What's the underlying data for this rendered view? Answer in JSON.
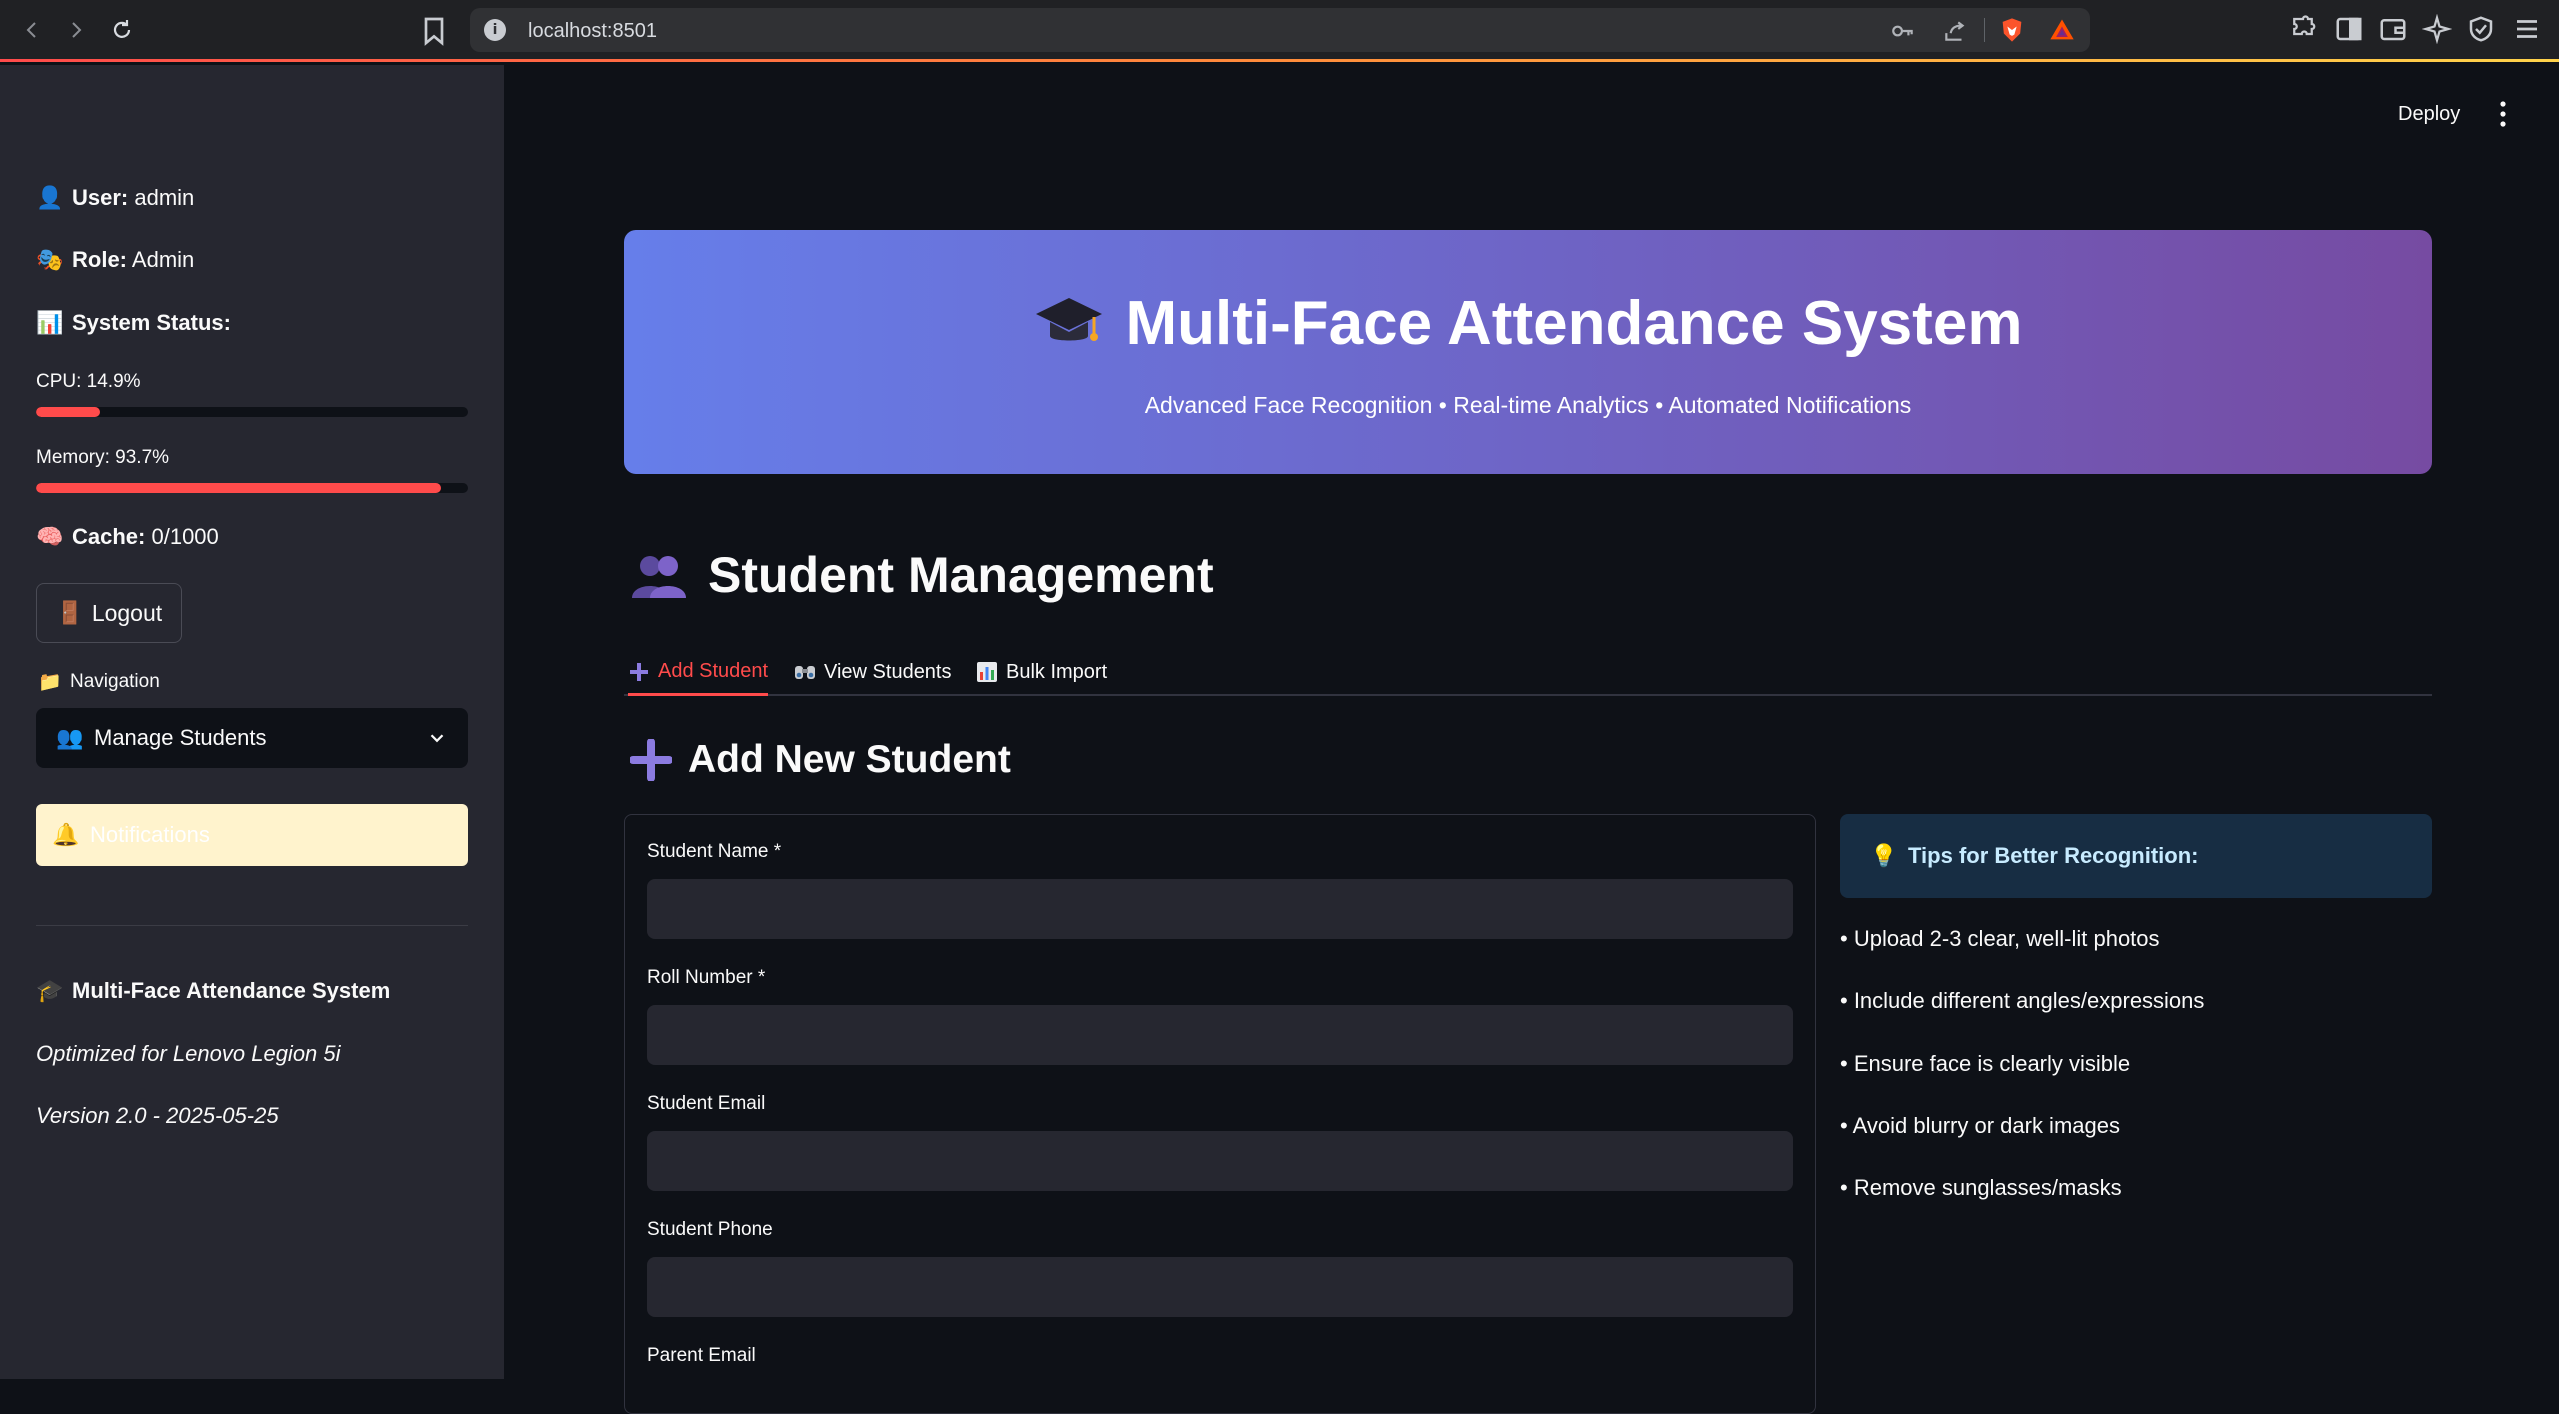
{
  "browser": {
    "url": "localhost:8501",
    "icons": [
      "back-icon",
      "forward-icon",
      "reload-icon",
      "bookmark-icon",
      "site-info-icon",
      "key-icon",
      "share-icon",
      "brave-shield-icon",
      "brave-rewards-icon",
      "extensions-icon",
      "sidebar-icon",
      "wallet-icon",
      "leo-ai-icon",
      "vpn-icon",
      "menu-icon"
    ]
  },
  "sidebar": {
    "user_label": "User:",
    "user_value": "admin",
    "role_label": "Role:",
    "role_value": "Admin",
    "system_status": "System Status:",
    "cpu_label": "CPU: 14.9%",
    "cpu_value": 14.9,
    "memory_label": "Memory: 93.7%",
    "memory_value": 93.7,
    "cache_label": "Cache:",
    "cache_value": "0/1000",
    "logout": "Logout",
    "navigation_label": "Navigation",
    "selected_page": "Manage Students",
    "notifications": "Notifications",
    "app_name": "Multi-Face Attendance System",
    "optimized": "Optimized for Lenovo Legion 5i",
    "version": "Version 2.0 - 2025-05-25"
  },
  "header": {
    "deploy": "Deploy"
  },
  "hero": {
    "title": "Multi-Face Attendance System",
    "subtitle": "Advanced Face Recognition • Real-time Analytics • Automated Notifications"
  },
  "main": {
    "section_title": "Student Management",
    "tabs": [
      {
        "label": "Add Student",
        "icon": "plus-icon",
        "active": true
      },
      {
        "label": "View Students",
        "icon": "binoculars-icon",
        "active": false
      },
      {
        "label": "Bulk Import",
        "icon": "bar-chart-icon",
        "active": false
      }
    ],
    "subsection_title": "Add New Student",
    "form": {
      "fields": [
        {
          "label": "Student Name *",
          "value": "",
          "placeholder": ""
        },
        {
          "label": "Roll Number *",
          "value": "",
          "placeholder": ""
        },
        {
          "label": "Student Email",
          "value": "",
          "placeholder": ""
        },
        {
          "label": "Student Phone",
          "value": "",
          "placeholder": ""
        },
        {
          "label": "Parent Email",
          "value": "",
          "placeholder": ""
        }
      ]
    },
    "tips": {
      "title": "Tips for Better Recognition:",
      "items": [
        "• Upload 2-3 clear, well-lit photos",
        "• Include different angles/expressions",
        "• Ensure face is clearly visible",
        "• Avoid blurry or dark images",
        "• Remove sunglasses/masks"
      ]
    }
  },
  "colors": {
    "accent": "#ff4b4b",
    "background": "#0e1117",
    "sidebar": "#262730",
    "hero_start": "#667eea",
    "hero_end": "#764ba2",
    "tips_bg": "#172d43",
    "notif_bg": "#fff3cd"
  }
}
